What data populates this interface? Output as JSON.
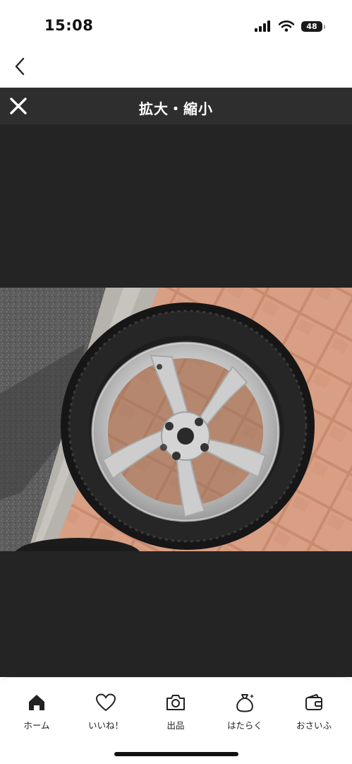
{
  "status_bar": {
    "time": "15:08",
    "battery": "48"
  },
  "viewer": {
    "title": "拡大・縮小"
  },
  "tabs": [
    {
      "label": "ホーム",
      "icon": "home-icon"
    },
    {
      "label": "いいね！",
      "icon": "heart-icon"
    },
    {
      "label": "出品",
      "icon": "camera-icon"
    },
    {
      "label": "はたらく",
      "icon": "money-bag-icon"
    },
    {
      "label": "おさいふ",
      "icon": "wallet-icon"
    }
  ],
  "colors": {
    "viewer_bg": "#242424",
    "viewer_header": "#2e2e2e",
    "active_tab": "#222222"
  }
}
